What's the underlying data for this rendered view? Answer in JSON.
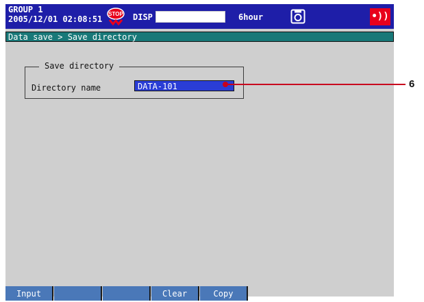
{
  "status_bar": {
    "group": "GROUP 1",
    "datetime": "2005/12/01 02:08:51",
    "stop_icon_text": "STOP",
    "disp_label": "DISP",
    "time_span": "6hour",
    "alarm_icon_text": "•))"
  },
  "breadcrumb": "Data save > Save directory",
  "panel": {
    "legend": "Save directory",
    "field_label": "Directory name",
    "field_value": "DATA-101"
  },
  "callout": "6",
  "softkeys": [
    "Input",
    "",
    "",
    "Clear",
    "Copy"
  ],
  "colors": {
    "status_bar_bg": "#1e1ea8",
    "breadcrumb_bg": "#187878",
    "input_bg": "#2a3dd6",
    "softkey_bg": "#4a78b8",
    "callout": "#c8001e",
    "alarm": "#e8001c"
  }
}
